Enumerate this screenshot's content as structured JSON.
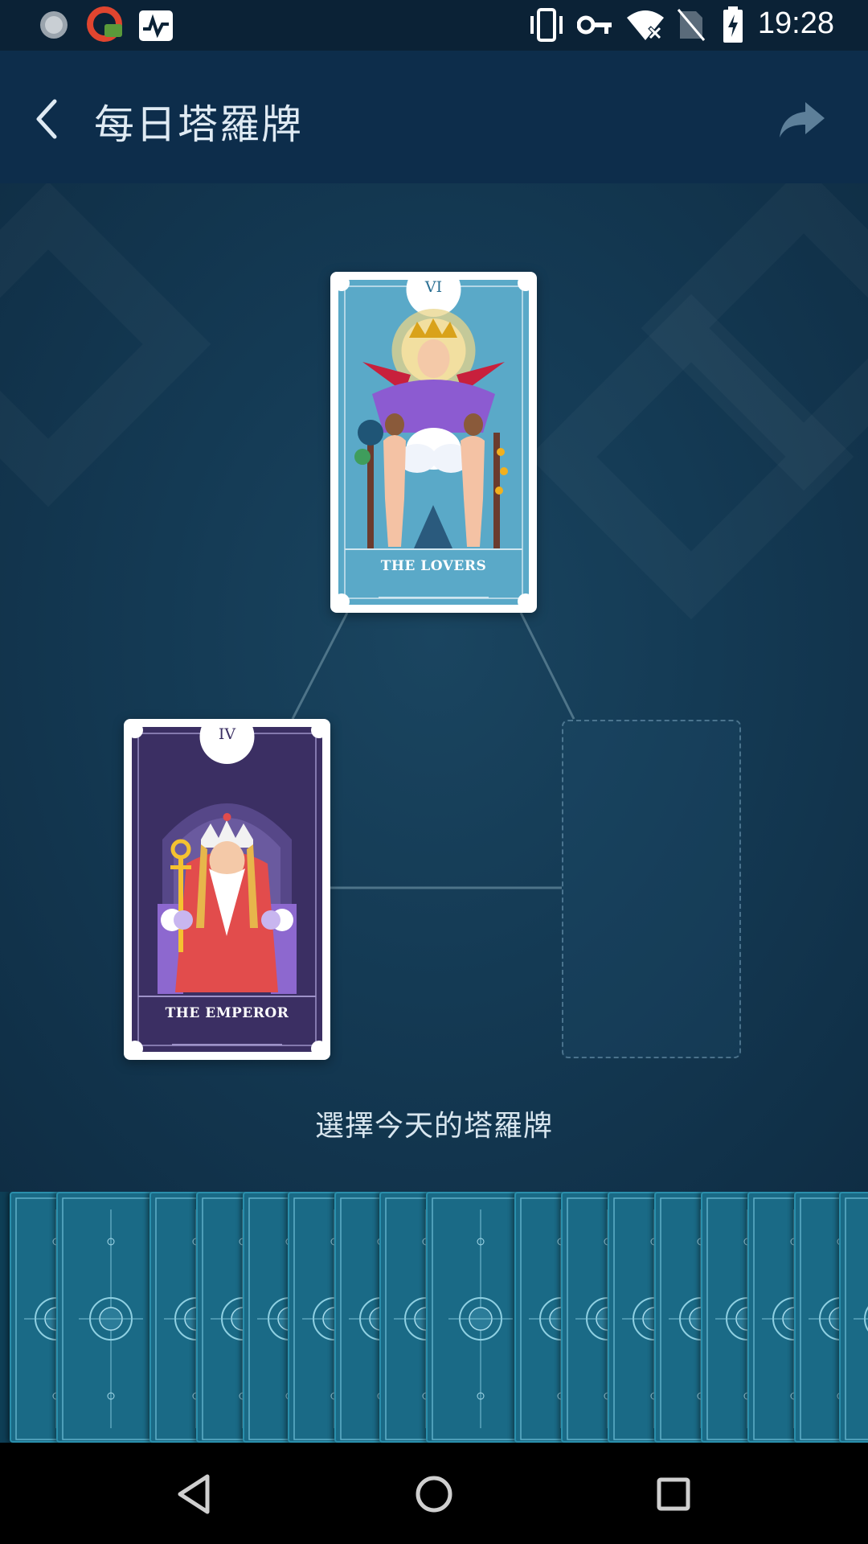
{
  "status_bar": {
    "time": "19:28",
    "left_icons": [
      "spinner-icon",
      "vpn-app-icon",
      "activity-icon"
    ],
    "right_icons": [
      "vibrate-icon",
      "key-icon",
      "wifi-off-icon",
      "no-sim-icon",
      "battery-charging-icon"
    ]
  },
  "app_bar": {
    "title": "每日塔羅牌",
    "back_icon": "back-arrow-icon",
    "share_icon": "share-arrow-icon"
  },
  "spread": {
    "cards": [
      {
        "numeral": "VI",
        "name": "THE LOVERS"
      },
      {
        "numeral": "IV",
        "name": "THE EMPEROR"
      }
    ],
    "empty_slot": true
  },
  "prompt": "選擇今天的塔羅牌",
  "deck": {
    "card_count": 19
  },
  "nav_bar": {
    "icons": [
      "back-triangle-icon",
      "home-circle-icon",
      "recents-square-icon"
    ]
  },
  "colors": {
    "app_bar": "#0d2d4b",
    "background": "#143a54",
    "lovers_card": "#5aa9c8",
    "emperor_card": "#3b2f63",
    "deck_card": "#1a6a86"
  }
}
